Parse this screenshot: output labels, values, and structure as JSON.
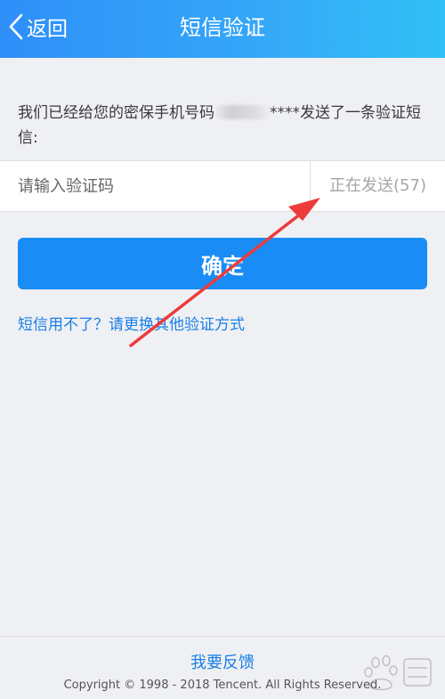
{
  "header": {
    "back_label": "返回",
    "title": "短信验证"
  },
  "notice": {
    "text_before_mask": "我们已经给您的密保手机号码",
    "text_after_mask": "****发送了一条验证短信:"
  },
  "verification": {
    "input_placeholder": "请输入验证码",
    "send_status": "正在发送(57)"
  },
  "actions": {
    "confirm_label": "确定",
    "alt_method_link": "短信用不了？请更换其他验证方式"
  },
  "footer": {
    "feedback_link": "我要反馈",
    "copyright": "Copyright © 1998 - 2018 Tencent. All Rights Reserved."
  },
  "colors": {
    "header_gradient_start": "#2e8ff8",
    "header_gradient_end": "#32c0f6",
    "primary_button": "#1a8cf5",
    "link": "#1a7fe6",
    "annotation_arrow": "#ee3b3b",
    "background": "#eff0f4"
  },
  "icons": {
    "back": "chevron-left-icon",
    "annotation": "red-arrow-annotation",
    "watermark": "baidu-paw-watermark"
  }
}
